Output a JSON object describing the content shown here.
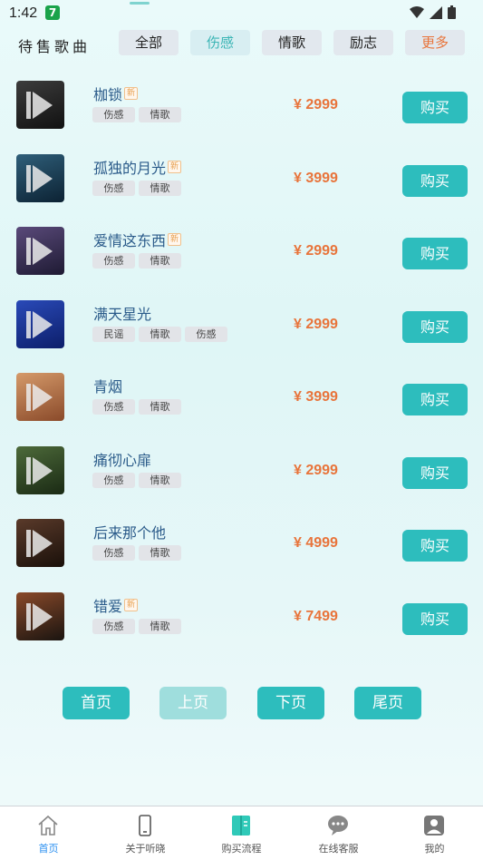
{
  "status_bar": {
    "time": "1:42",
    "notification_badge": "7"
  },
  "header": {
    "title": "待售歌曲",
    "chips": [
      {
        "label": "全部",
        "state": "normal"
      },
      {
        "label": "伤感",
        "state": "active"
      },
      {
        "label": "情歌",
        "state": "normal"
      },
      {
        "label": "励志",
        "state": "normal"
      },
      {
        "label": "更多",
        "state": "more"
      }
    ]
  },
  "songs": [
    {
      "name": "枷锁",
      "is_new": true,
      "new_label": "新",
      "tags": [
        "伤感",
        "情歌"
      ],
      "price": "¥ 2999",
      "buy_label": "购买",
      "thumb_colors": [
        "#3c3c3c",
        "#111111"
      ]
    },
    {
      "name": "孤独的月光",
      "is_new": true,
      "new_label": "新",
      "tags": [
        "伤感",
        "情歌"
      ],
      "price": "¥ 3999",
      "buy_label": "购买",
      "thumb_colors": [
        "#2f5f7a",
        "#0c2233"
      ]
    },
    {
      "name": "爱情这东西",
      "is_new": true,
      "new_label": "新",
      "tags": [
        "伤感",
        "情歌"
      ],
      "price": "¥ 2999",
      "buy_label": "购买",
      "thumb_colors": [
        "#5a4a7a",
        "#1e1a33"
      ]
    },
    {
      "name": "满天星光",
      "is_new": false,
      "new_label": "",
      "tags": [
        "民谣",
        "情歌",
        "伤感"
      ],
      "price": "¥ 2999",
      "buy_label": "购买",
      "thumb_colors": [
        "#2a4ab8",
        "#0c1e6a"
      ]
    },
    {
      "name": "青烟",
      "is_new": false,
      "new_label": "",
      "tags": [
        "伤感",
        "情歌"
      ],
      "price": "¥ 3999",
      "buy_label": "购买",
      "thumb_colors": [
        "#d59a6a",
        "#8a4a2a"
      ]
    },
    {
      "name": "痛彻心扉",
      "is_new": false,
      "new_label": "",
      "tags": [
        "伤感",
        "情歌"
      ],
      "price": "¥ 2999",
      "buy_label": "购买",
      "thumb_colors": [
        "#4d6a3a",
        "#1a2a14"
      ]
    },
    {
      "name": "后来那个他",
      "is_new": false,
      "new_label": "",
      "tags": [
        "伤感",
        "情歌"
      ],
      "price": "¥ 4999",
      "buy_label": "购买",
      "thumb_colors": [
        "#5a3a2a",
        "#1a100a"
      ]
    },
    {
      "name": "错爱",
      "is_new": true,
      "new_label": "新",
      "tags": [
        "伤感",
        "情歌"
      ],
      "price": "¥ 7499",
      "buy_label": "购买",
      "thumb_colors": [
        "#8a4a2a",
        "#1a1410"
      ]
    }
  ],
  "pager": {
    "first": "首页",
    "prev": "上页",
    "next": "下页",
    "last": "尾页"
  },
  "bottom_nav": [
    {
      "label": "首页",
      "icon": "home-icon",
      "active": true
    },
    {
      "label": "关于听晓",
      "icon": "phone-icon",
      "active": false
    },
    {
      "label": "购买流程",
      "icon": "book-icon",
      "active": false
    },
    {
      "label": "在线客服",
      "icon": "chat-icon",
      "active": false
    },
    {
      "label": "我的",
      "icon": "user-icon",
      "active": false
    }
  ],
  "colors": {
    "accent": "#2dbdbd",
    "price": "#e8743b",
    "title": "#2b5b8a",
    "active_nav": "#2a8ff0"
  }
}
